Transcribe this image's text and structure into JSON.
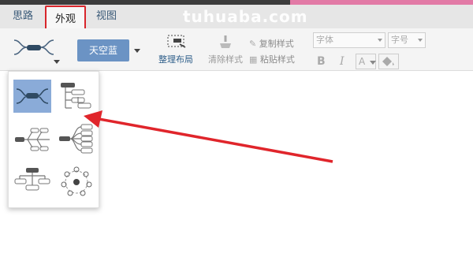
{
  "watermark": "tuhuaba.com",
  "tabs": [
    {
      "label": "思路"
    },
    {
      "label": "外观"
    },
    {
      "label": "视图"
    }
  ],
  "toolbar": {
    "theme_label": "天空蓝",
    "arrange_label": "整理布局",
    "clear_style_label": "清除样式",
    "copy_style_label": "复制样式",
    "paste_style_label": "粘贴样式",
    "font_placeholder": "字体",
    "size_placeholder": "字号",
    "bold_label": "B",
    "italic_label": "I",
    "font_color_label": "A"
  },
  "layout_options": [
    {
      "name": "mind-map",
      "selected": true
    },
    {
      "name": "org-tree-right",
      "selected": false
    },
    {
      "name": "fishbone",
      "selected": false
    },
    {
      "name": "bracket-right",
      "selected": false
    },
    {
      "name": "org-tree-down",
      "selected": false
    },
    {
      "name": "circle-radial",
      "selected": false
    }
  ],
  "colors": {
    "accent": "#6b93c4",
    "selected_bg": "#8aabd8",
    "highlight_border": "#d8252b",
    "arrow": "#e0252b"
  }
}
